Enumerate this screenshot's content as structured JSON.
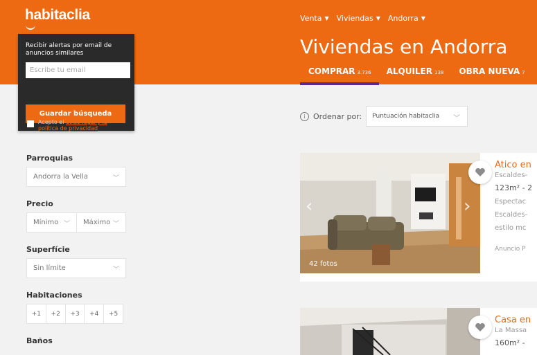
{
  "header": {
    "logo": "habitaclia",
    "breadcrumb": [
      "Venta",
      "Viviendas",
      "Andorra"
    ],
    "title": "Viviendas en Andorra",
    "tabs": [
      {
        "label": "COMPRAR",
        "count": "3.736",
        "active": true
      },
      {
        "label": "ALQUILER",
        "count": "138",
        "active": false
      },
      {
        "label": "OBRA NUEVA",
        "count": "7",
        "active": false
      }
    ],
    "brand_color": "#ee6a12",
    "tab_indicator_color": "#5a2a86"
  },
  "alert": {
    "title": "Recibir alertas por email de anuncios similares",
    "email_placeholder": "Escribe tu email",
    "consent_prefix": "Acepto el ",
    "consent_link": "aviso legal y la política de privacidad",
    "save_label": "Guardar búsqueda"
  },
  "filters": {
    "parroquias_label": "Parroquias",
    "parroquias_value": "Andorra la Vella",
    "precio_label": "Precio",
    "precio_min": "Mínimo",
    "precio_max": "Máximo",
    "superficie_label": "Superfície",
    "superficie_value": "Sin límite",
    "habitaciones_label": "Habitaciones",
    "habitaciones_options": [
      "+1",
      "+2",
      "+3",
      "+4",
      "+5"
    ],
    "banos_label": "Baños"
  },
  "sort": {
    "label": "Ordenar por:",
    "value": "Puntuación habitaclia"
  },
  "listings": [
    {
      "title": "Ático en",
      "location": "Escaldes-",
      "size": "123m² - 2",
      "desc": [
        "Espectac",
        "Escaldes-",
        "estilo mc"
      ],
      "ad": "Anuncio P",
      "photos": "42 fotos"
    },
    {
      "title": "Casa en",
      "location": "La Massa",
      "size": "160m² -"
    }
  ]
}
